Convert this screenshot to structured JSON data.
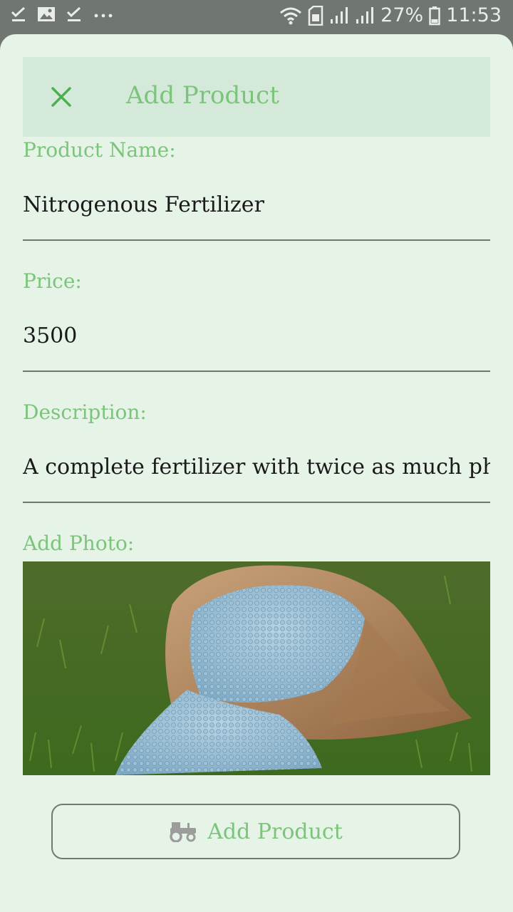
{
  "status_bar": {
    "battery": "27%",
    "time": "11:53",
    "icons": [
      "checkmark-icon",
      "image-icon",
      "checkmark-icon",
      "more-dots-icon",
      "wifi-icon",
      "sim-icon",
      "signal-icon",
      "signal-icon",
      "battery-icon"
    ]
  },
  "header": {
    "close_icon": "close-icon",
    "title": "Add Product"
  },
  "form": {
    "name_label": "Product Name:",
    "name_value": "Nitrogenous Fertilizer",
    "price_label": "Price:",
    "price_value": "3500",
    "description_label": "Description:",
    "description_value": "A complete fertilizer with twice as much phosphorus",
    "photo_label": "Add Photo:"
  },
  "submit": {
    "icon": "tractor-icon",
    "label": "Add Product"
  },
  "colors": {
    "accent": "#7cc47c",
    "close_icon": "#4caf50",
    "sheet_background": "#e6f4e7",
    "header_background": "#d5e9da",
    "status_bar": "#707670"
  }
}
